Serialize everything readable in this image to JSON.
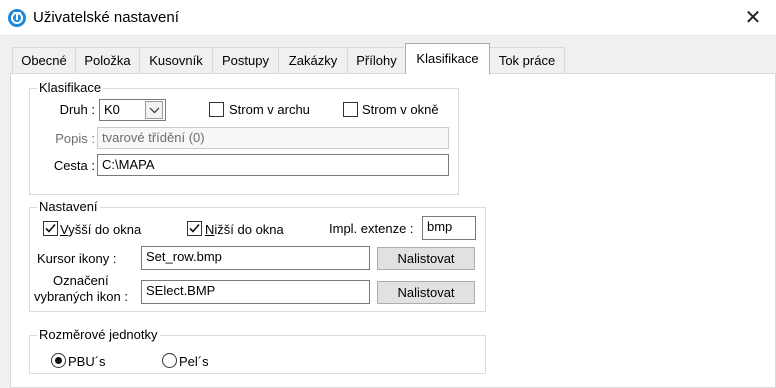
{
  "window": {
    "title": "Uživatelské nastavení",
    "app_icon_letter": "T",
    "close_glyph": "✕"
  },
  "tabs": [
    {
      "label": "Obecné"
    },
    {
      "label": "Položka"
    },
    {
      "label": "Kusovník"
    },
    {
      "label": "Postupy"
    },
    {
      "label": "Zakázky"
    },
    {
      "label": "Přílohy"
    },
    {
      "label": "Klasifikace",
      "active": true
    },
    {
      "label": "Tok práce"
    }
  ],
  "klasifikace": {
    "legend": "Klasifikace",
    "druh_label": "Druh :",
    "druh_value": "K0",
    "strom_v_archu_label": "Strom v archu",
    "strom_v_archu_checked": false,
    "strom_v_okne_label": "Strom v okně",
    "strom_v_okne_checked": false,
    "popis_label": "Popis :",
    "popis_value": "tvarové třídění (0)",
    "cesta_label": "Cesta :",
    "cesta_value": "C:\\MAPA"
  },
  "nastaveni": {
    "legend": "Nastavení",
    "vyssi_first": "V",
    "vyssi_rest": "yšší do okna",
    "vyssi_checked": true,
    "nizsi_first": "N",
    "nizsi_rest": "ižší do okna",
    "nizsi_checked": true,
    "impl_label": "Impl. extenze :",
    "impl_value": "bmp",
    "kursor_label": "Kursor ikony :",
    "kursor_value": "Set_row.bmp",
    "kursor_button": "Nalistovat",
    "oznaceni_label_1": "Označení",
    "oznaceni_label_2": "vybraných ikon :",
    "oznaceni_value": "SElect.BMP",
    "oznaceni_button": "Nalistovat"
  },
  "rozmerove": {
    "legend": "Rozměrové jednotky",
    "options": [
      {
        "label": "PBU´s",
        "selected": true
      },
      {
        "label": "Pel´s",
        "selected": false
      }
    ]
  }
}
